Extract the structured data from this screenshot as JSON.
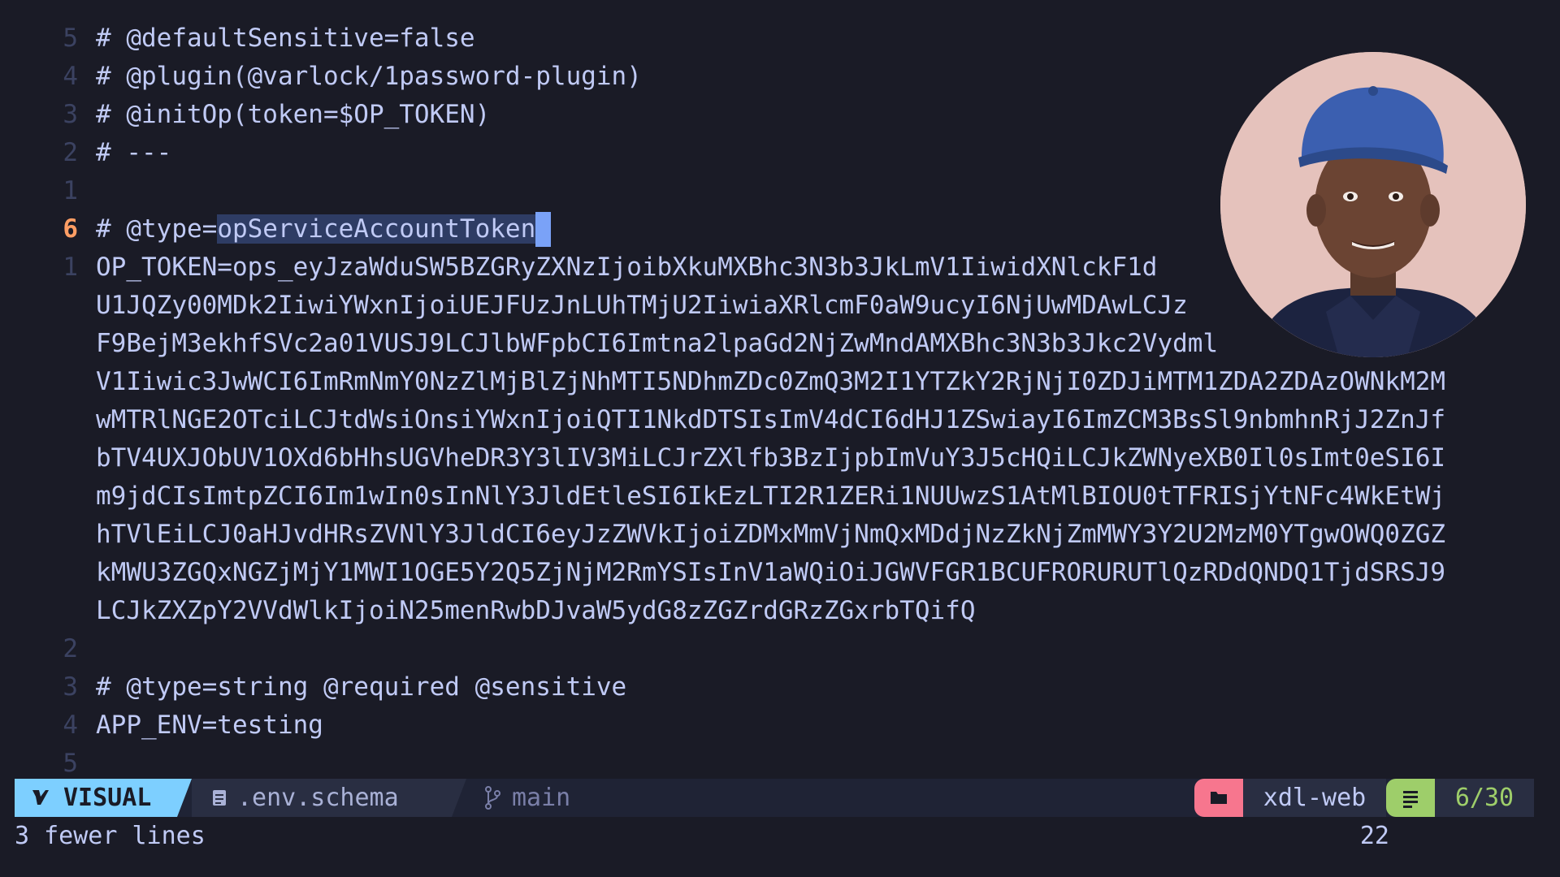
{
  "editor": {
    "lines": [
      {
        "num": "5",
        "text": "# @defaultSensitive=false"
      },
      {
        "num": "4",
        "text": "# @plugin(@varlock/1password-plugin)"
      },
      {
        "num": "3",
        "text": "# @initOp(token=$OP_TOKEN)"
      },
      {
        "num": "2",
        "text": "# ---"
      },
      {
        "num": "1",
        "text": ""
      },
      {
        "num": "6",
        "text_before": "# @type=",
        "text_selected": "opServiceAccountToken",
        "cursor_char": " "
      },
      {
        "num": "1",
        "text": "OP_TOKEN=ops_eyJzaWduSW5BZGRyZXNzIjoibXkuMXBhc3N3b3JkLmV1IiwidXNlckF1d"
      },
      {
        "num": "",
        "text": "U1JQZy00MDk2IiwiYWxnIjoiUEJFUzJnLUhTMjU2IiwiaXRlcmF0aW9ucyI6NjUwMDAwLCJz"
      },
      {
        "num": "",
        "text": "F9BejM3ekhfSVc2a01VUSJ9LCJlbWFpbCI6Imtna2lpaGd2NjZwMndAMXBhc3N3b3Jkc2Vydml"
      },
      {
        "num": "",
        "text": "V1Iiwic3JwWCI6ImRmNmY0NzZlMjBlZjNhMTI5NDhmZDc0ZmQ3M2I1YTZkY2RjNjI0ZDJiMTM1ZDA2ZDAzOWNkM2M"
      },
      {
        "num": "",
        "text": "wMTRlNGE2OTciLCJtdWsiOnsiYWxnIjoiQTI1NkdDTSIsImV4dCI6dHJ1ZSwiayI6ImZCM3BsSl9nbmhnRjJ2ZnJf"
      },
      {
        "num": "",
        "text": "bTV4UXJObUV1OXd6bHhsUGVheDR3Y3lIV3MiLCJrZXlfb3BzIjpbImVuY3J5cHQiLCJkZWNyeXB0Il0sImt0eSI6I"
      },
      {
        "num": "",
        "text": "m9jdCIsImtpZCI6Im1wIn0sInNlY3JldEtleSI6IkEzLTI2R1ZERi1NUUwzS1AtMlBIOU0tTFRISjYtNFc4WkEtWj"
      },
      {
        "num": "",
        "text": "hTVlEiLCJ0aHJvdHRsZVNlY3JldCI6eyJzZWVkIjoiZDMxMmVjNmQxMDdjNzZkNjZmMWY3Y2U2MzM0YTgwOWQ0ZGZ"
      },
      {
        "num": "",
        "text": "kMWU3ZGQxNGZjMjY1MWI1OGE5Y2Q5ZjNjM2RmYSIsInV1aWQiOiJGWVFGR1BCUFRORURUTlQzRDdQNDQ1TjdSRSJ9"
      },
      {
        "num": "",
        "text": "LCJkZXZpY2VVdWlkIjoiN25menRwbDJvaW5ydG8zZGZrdGRzZGxrbTQifQ"
      },
      {
        "num": "2",
        "text": ""
      },
      {
        "num": "3",
        "text": "# @type=string @required @sensitive"
      },
      {
        "num": "4",
        "text": "APP_ENV=testing"
      },
      {
        "num": "5",
        "text": ""
      }
    ]
  },
  "statusbar": {
    "mode": "VISUAL",
    "mode_icon": "vim-icon",
    "file_icon": "file-icon",
    "filename": ".env.schema",
    "branch_icon": "git-branch-icon",
    "branch": "main",
    "project_icon": "folder-icon",
    "project": "xdl-web",
    "position_icon": "lines-icon",
    "position": "6/30"
  },
  "cmdline": {
    "message": "3 fewer lines",
    "count": "22"
  },
  "colors": {
    "background": "#1a1b26",
    "mode_bg": "#7dcfff",
    "project_accent": "#f7768e",
    "position_accent": "#9ece6a",
    "current_line_number": "#ff9e64",
    "selection": "#2e3c64"
  }
}
